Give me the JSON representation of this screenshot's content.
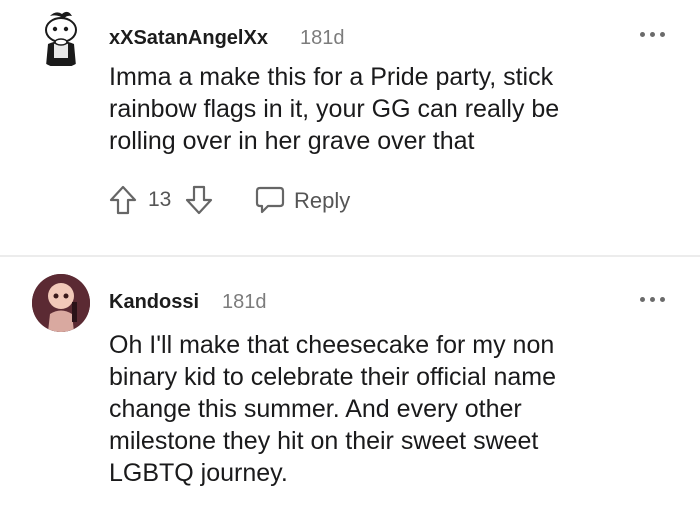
{
  "comments": [
    {
      "username": "xXSatanAngelXx",
      "age": "181d",
      "text": "Imma a make this for a Pride party, stick\nrainbow flags in it, your GG can really be\nrolling over in her grave over that",
      "score": "13",
      "reply_label": "Reply"
    },
    {
      "username": "Kandossi",
      "age": "181d",
      "text": "Oh I'll make that cheesecake for my non\nbinary kid to celebrate their official name\nchange this summer. And every other\nmilestone they hit on their sweet sweet\nLGBTQ journey."
    }
  ],
  "icons": {
    "upvote": "arrow-up-icon",
    "downvote": "arrow-down-icon",
    "reply": "speech-bubble-icon",
    "more": "more-horizontal-icon"
  }
}
